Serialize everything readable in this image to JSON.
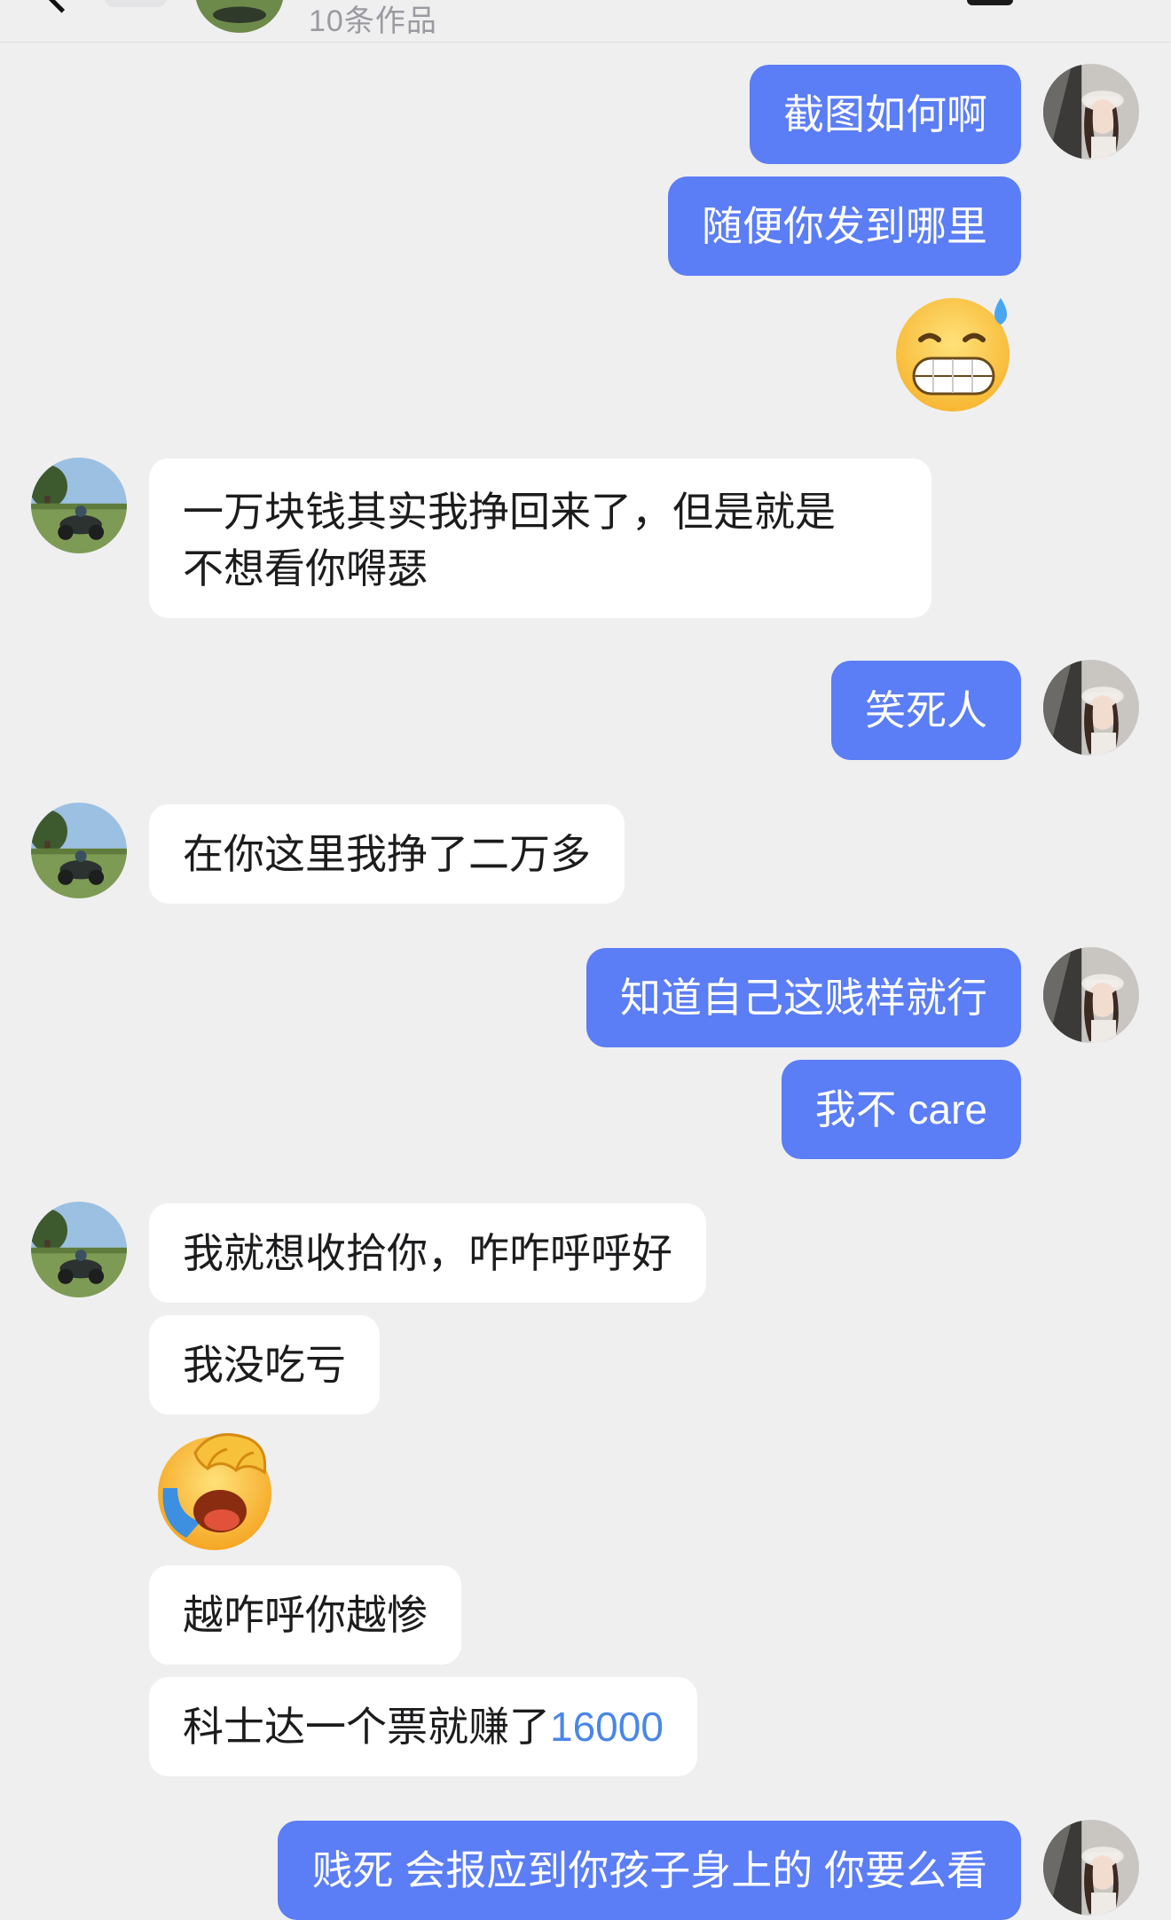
{
  "header": {
    "subtitle": "10条作品"
  },
  "icons": {
    "back": "chevron-left-icon",
    "me_avatar": "woman-avatar",
    "other_avatar": "atv-avatar",
    "grimace_emoji": "grimacing-sweat-emoji",
    "facepalm_emoji": "facepalm-crying-emoji"
  },
  "colors": {
    "background": "#efeff0",
    "my_bubble": "#5b7df5",
    "their_bubble": "#ffffff",
    "number_link": "#4a86e8"
  },
  "messages": [
    {
      "from": "me",
      "text": "截图如何啊"
    },
    {
      "from": "me",
      "text": "随便你发到哪里"
    },
    {
      "from": "me",
      "emoji": "grimacing-sweat-emoji"
    },
    {
      "from": "other",
      "text_line1": "一万块钱其实我挣回来了，但是就是",
      "text_line2": "不想看你嘚瑟"
    },
    {
      "from": "me",
      "text": "笑死人"
    },
    {
      "from": "other",
      "text": "在你这里我挣了二万多"
    },
    {
      "from": "me",
      "text": "知道自己这贱样就行"
    },
    {
      "from": "me",
      "text": "我不 care"
    },
    {
      "from": "other",
      "text": "我就想收拾你，咋咋呼呼好"
    },
    {
      "from": "other",
      "text": "我没吃亏"
    },
    {
      "from": "other",
      "emoji": "facepalm-crying-emoji"
    },
    {
      "from": "other",
      "text": "越咋呼你越惨"
    },
    {
      "from": "other",
      "text_prefix": "科士达一个票就赚了",
      "number": "16000"
    },
    {
      "from": "me",
      "text": "贱死 会报应到你孩子身上的 你要么看"
    }
  ]
}
